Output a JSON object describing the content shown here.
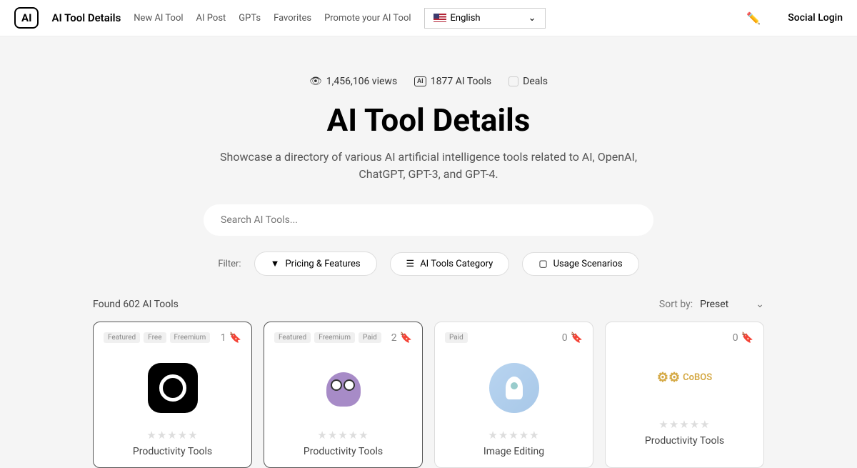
{
  "header": {
    "logo": "AI",
    "brand": "AI Tool Details",
    "nav": [
      "New AI Tool",
      "AI Post",
      "GPTs",
      "Favorites",
      "Promote your AI Tool"
    ],
    "language": "English",
    "socialLogin": "Social Login"
  },
  "hero": {
    "views": "1,456,106 views",
    "toolCount": "1877 AI Tools",
    "deals": "Deals",
    "title": "AI Tool Details",
    "subtitle": "Showcase a directory of various AI artificial intelligence tools related to AI, OpenAI, ChatGPT, GPT-3, and GPT-4.",
    "searchPlaceholder": "Search AI Tools..."
  },
  "filters": {
    "label": "Filter:",
    "buttons": [
      "Pricing & Features",
      "AI Tools Category",
      "Usage Scenarios"
    ]
  },
  "results": {
    "found": "Found 602 AI Tools",
    "sortLabel": "Sort by:",
    "sortValue": "Preset"
  },
  "cards": [
    {
      "tags": [
        "Featured",
        "Free",
        "Freemium"
      ],
      "bookmarks": "1",
      "category": "Productivity Tools"
    },
    {
      "tags": [
        "Featured",
        "Freemium",
        "Paid"
      ],
      "bookmarks": "2",
      "category": "Productivity Tools"
    },
    {
      "tags": [
        "Paid"
      ],
      "bookmarks": "0",
      "category": "Image Editing"
    },
    {
      "tags": [],
      "bookmarks": "0",
      "category": "Productivity Tools",
      "brandText": "CoBOS"
    }
  ]
}
